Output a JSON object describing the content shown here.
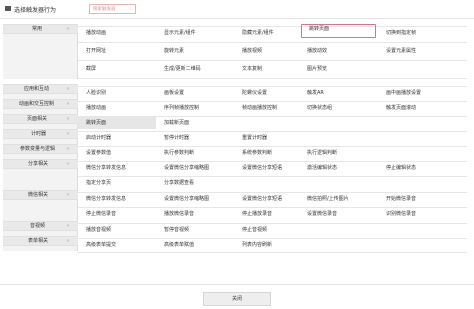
{
  "header": {
    "title": "选择触发器行为",
    "search_placeholder": "搜索触发器"
  },
  "categories": [
    {
      "label": "常用",
      "rows": [
        [
          "播放动画",
          "显示元素/组件",
          "隐藏元素/组件",
          "跳转页面",
          "切换到指定帧"
        ],
        [
          "打开网址",
          "旋转元素",
          "播放视频",
          "播放动效",
          "设置元素属性"
        ],
        [
          "截屏",
          "生成/更新二维码",
          "文本复制",
          "图片预览",
          ""
        ]
      ]
    },
    {
      "label": "应用和互动",
      "rows": [
        [
          "人脸识别",
          "画板设置",
          "陀螺仪设置",
          "触发AR",
          "画中画播放设置"
        ]
      ]
    },
    {
      "label": "动画和交互控制",
      "rows": [
        [
          "播放动画",
          "序列帧播放控制",
          "帧动画播放控制",
          "切换状态组",
          "触发页面滚动"
        ]
      ]
    },
    {
      "label": "页面相关",
      "rows": [
        [
          "跳转页面",
          "加载新页面",
          "",
          "",
          ""
        ]
      ]
    },
    {
      "label": "计时器",
      "rows": [
        [
          "启动计时器",
          "暂停计时器",
          "重置计时器",
          "",
          ""
        ]
      ]
    },
    {
      "label": "参数变量与逻辑",
      "rows": [
        [
          "设置参数值",
          "执行参数判断",
          "系统参数判断",
          "执行逻辑判断",
          ""
        ]
      ]
    },
    {
      "label": "分享相关",
      "rows": [
        [
          "微信分享转发信息",
          "设置微信分享缩略图",
          "设置微信分享短语",
          "激活编辑状态",
          "停止编辑状态"
        ],
        [
          "指定分享页",
          "分享数据查看",
          "",
          "",
          ""
        ]
      ]
    },
    {
      "label": "微信相关",
      "rows": [
        [
          "微信分享转发信息",
          "设置微信分享缩略图",
          "设置微信分享短语",
          "微信拍照/上传图片",
          "开始微信录音"
        ],
        [
          "停止微信录音",
          "播放微信录音",
          "停止播放录音",
          "设置微信录音",
          "识别微信录音"
        ]
      ]
    },
    {
      "label": "音视频",
      "rows": [
        [
          "播放音视频",
          "暂停音视频",
          "停止音视频",
          "",
          ""
        ]
      ]
    },
    {
      "label": "表单相关",
      "rows": [
        [
          "高级表单提交",
          "高级表单赋值",
          "列表内容刷新",
          "",
          ""
        ]
      ]
    }
  ],
  "selected_item": "跳转页面",
  "highlighted_item": "跳转页面",
  "footer": {
    "close_label": "关闭"
  }
}
